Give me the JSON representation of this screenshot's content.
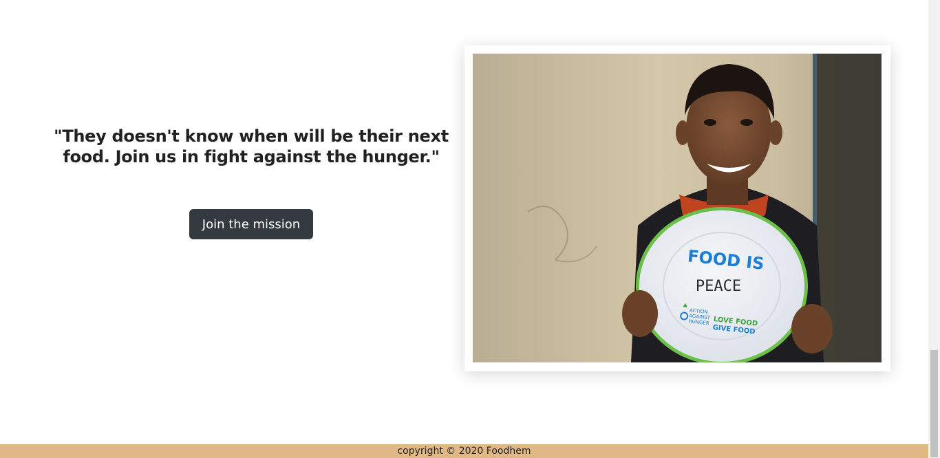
{
  "hero": {
    "quote": "\"They doesn't know when will be their next food. Join us in fight against the hunger.\"",
    "cta_label": "Join the mission"
  },
  "photo": {
    "plate_headline": "FOOD IS",
    "plate_handwritten": "PEACE",
    "plate_logo_left": [
      "ACTION",
      "AGAINST",
      "HUNGER"
    ],
    "plate_logo_right": [
      "LOVE FOOD",
      "GIVE FOOD"
    ]
  },
  "footer": {
    "copyright": "copyright © 2020 Foodhem"
  },
  "colors": {
    "button": "#343a40",
    "footer": "#dfb886",
    "plate_text": "#1a7fd4",
    "plate_rim": "#6cc04a"
  }
}
